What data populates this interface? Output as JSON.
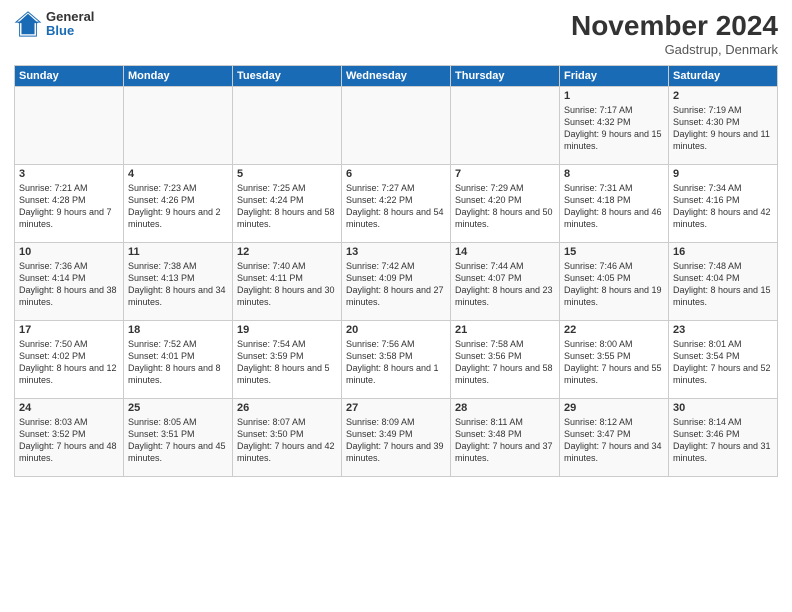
{
  "logo": {
    "general": "General",
    "blue": "Blue"
  },
  "header": {
    "month": "November 2024",
    "location": "Gadstrup, Denmark"
  },
  "weekdays": [
    "Sunday",
    "Monday",
    "Tuesday",
    "Wednesday",
    "Thursday",
    "Friday",
    "Saturday"
  ],
  "weeks": [
    [
      {
        "day": "",
        "info": ""
      },
      {
        "day": "",
        "info": ""
      },
      {
        "day": "",
        "info": ""
      },
      {
        "day": "",
        "info": ""
      },
      {
        "day": "",
        "info": ""
      },
      {
        "day": "1",
        "info": "Sunrise: 7:17 AM\nSunset: 4:32 PM\nDaylight: 9 hours and 15 minutes."
      },
      {
        "day": "2",
        "info": "Sunrise: 7:19 AM\nSunset: 4:30 PM\nDaylight: 9 hours and 11 minutes."
      }
    ],
    [
      {
        "day": "3",
        "info": "Sunrise: 7:21 AM\nSunset: 4:28 PM\nDaylight: 9 hours and 7 minutes."
      },
      {
        "day": "4",
        "info": "Sunrise: 7:23 AM\nSunset: 4:26 PM\nDaylight: 9 hours and 2 minutes."
      },
      {
        "day": "5",
        "info": "Sunrise: 7:25 AM\nSunset: 4:24 PM\nDaylight: 8 hours and 58 minutes."
      },
      {
        "day": "6",
        "info": "Sunrise: 7:27 AM\nSunset: 4:22 PM\nDaylight: 8 hours and 54 minutes."
      },
      {
        "day": "7",
        "info": "Sunrise: 7:29 AM\nSunset: 4:20 PM\nDaylight: 8 hours and 50 minutes."
      },
      {
        "day": "8",
        "info": "Sunrise: 7:31 AM\nSunset: 4:18 PM\nDaylight: 8 hours and 46 minutes."
      },
      {
        "day": "9",
        "info": "Sunrise: 7:34 AM\nSunset: 4:16 PM\nDaylight: 8 hours and 42 minutes."
      }
    ],
    [
      {
        "day": "10",
        "info": "Sunrise: 7:36 AM\nSunset: 4:14 PM\nDaylight: 8 hours and 38 minutes."
      },
      {
        "day": "11",
        "info": "Sunrise: 7:38 AM\nSunset: 4:13 PM\nDaylight: 8 hours and 34 minutes."
      },
      {
        "day": "12",
        "info": "Sunrise: 7:40 AM\nSunset: 4:11 PM\nDaylight: 8 hours and 30 minutes."
      },
      {
        "day": "13",
        "info": "Sunrise: 7:42 AM\nSunset: 4:09 PM\nDaylight: 8 hours and 27 minutes."
      },
      {
        "day": "14",
        "info": "Sunrise: 7:44 AM\nSunset: 4:07 PM\nDaylight: 8 hours and 23 minutes."
      },
      {
        "day": "15",
        "info": "Sunrise: 7:46 AM\nSunset: 4:05 PM\nDaylight: 8 hours and 19 minutes."
      },
      {
        "day": "16",
        "info": "Sunrise: 7:48 AM\nSunset: 4:04 PM\nDaylight: 8 hours and 15 minutes."
      }
    ],
    [
      {
        "day": "17",
        "info": "Sunrise: 7:50 AM\nSunset: 4:02 PM\nDaylight: 8 hours and 12 minutes."
      },
      {
        "day": "18",
        "info": "Sunrise: 7:52 AM\nSunset: 4:01 PM\nDaylight: 8 hours and 8 minutes."
      },
      {
        "day": "19",
        "info": "Sunrise: 7:54 AM\nSunset: 3:59 PM\nDaylight: 8 hours and 5 minutes."
      },
      {
        "day": "20",
        "info": "Sunrise: 7:56 AM\nSunset: 3:58 PM\nDaylight: 8 hours and 1 minute."
      },
      {
        "day": "21",
        "info": "Sunrise: 7:58 AM\nSunset: 3:56 PM\nDaylight: 7 hours and 58 minutes."
      },
      {
        "day": "22",
        "info": "Sunrise: 8:00 AM\nSunset: 3:55 PM\nDaylight: 7 hours and 55 minutes."
      },
      {
        "day": "23",
        "info": "Sunrise: 8:01 AM\nSunset: 3:54 PM\nDaylight: 7 hours and 52 minutes."
      }
    ],
    [
      {
        "day": "24",
        "info": "Sunrise: 8:03 AM\nSunset: 3:52 PM\nDaylight: 7 hours and 48 minutes."
      },
      {
        "day": "25",
        "info": "Sunrise: 8:05 AM\nSunset: 3:51 PM\nDaylight: 7 hours and 45 minutes."
      },
      {
        "day": "26",
        "info": "Sunrise: 8:07 AM\nSunset: 3:50 PM\nDaylight: 7 hours and 42 minutes."
      },
      {
        "day": "27",
        "info": "Sunrise: 8:09 AM\nSunset: 3:49 PM\nDaylight: 7 hours and 39 minutes."
      },
      {
        "day": "28",
        "info": "Sunrise: 8:11 AM\nSunset: 3:48 PM\nDaylight: 7 hours and 37 minutes."
      },
      {
        "day": "29",
        "info": "Sunrise: 8:12 AM\nSunset: 3:47 PM\nDaylight: 7 hours and 34 minutes."
      },
      {
        "day": "30",
        "info": "Sunrise: 8:14 AM\nSunset: 3:46 PM\nDaylight: 7 hours and 31 minutes."
      }
    ]
  ]
}
